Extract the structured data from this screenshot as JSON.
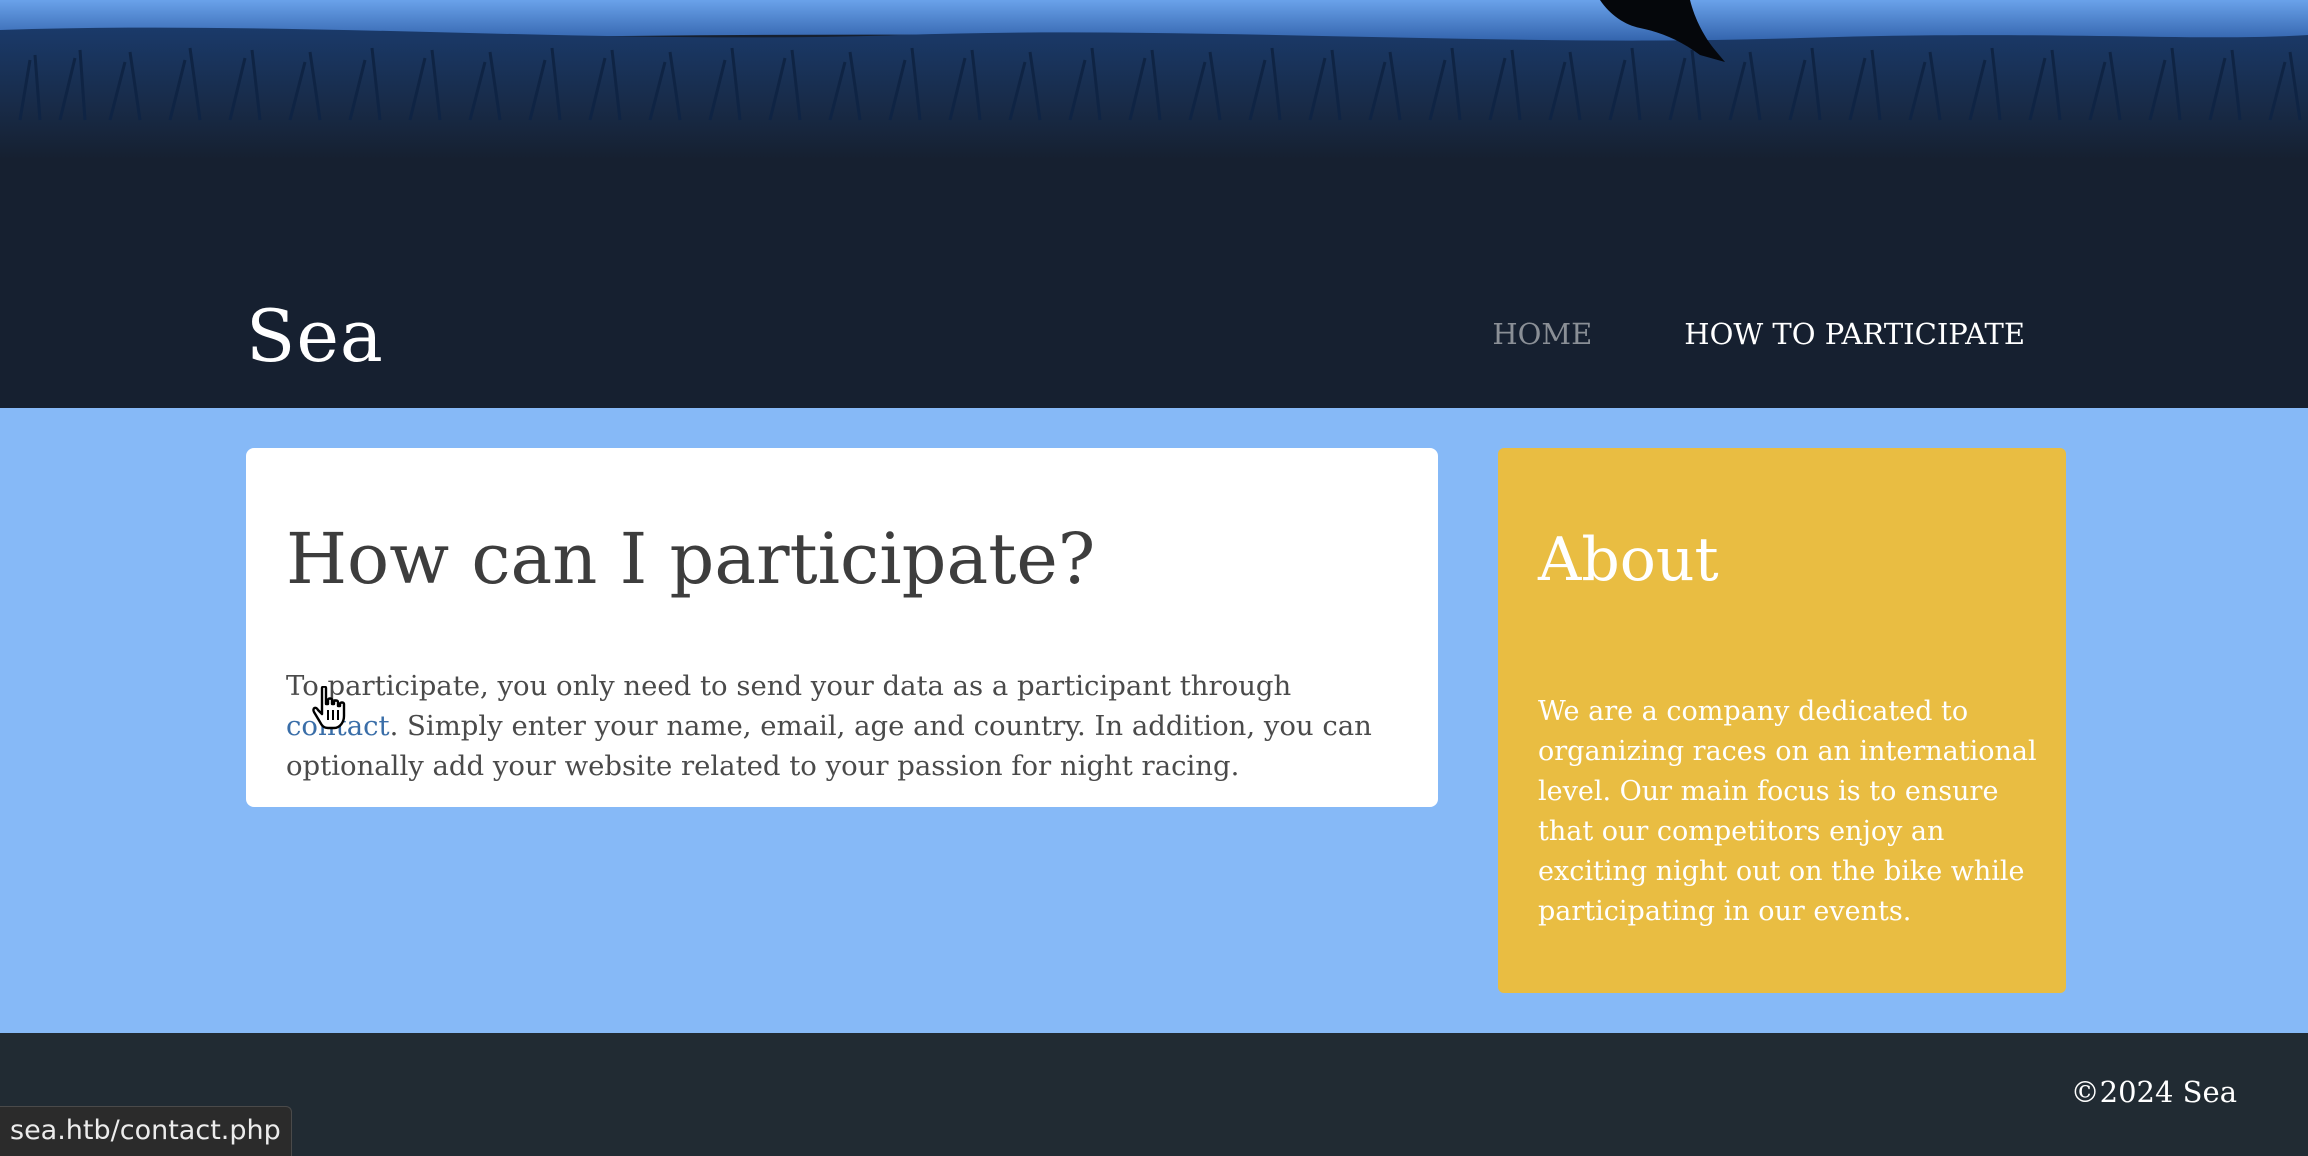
{
  "header": {
    "site_title": "Sea",
    "nav": {
      "home": "HOME",
      "participate": "HOW TO PARTICIPATE"
    }
  },
  "main": {
    "heading": "How can I participate?",
    "intro_before": "To participate, you only need to send your data as a participant through ",
    "contact_link": "contact",
    "intro_after": ". Simply enter your name, email, age and country. In addition, you can optionally add your website related to your passion for night racing."
  },
  "about": {
    "heading": "About",
    "body": "We are a company dedicated to organizing races on an international level. Our main focus is to ensure that our competitors enjoy an exciting night out on the bike while participating in our events."
  },
  "footer": {
    "copyright": "©2024 Sea"
  },
  "status_bar": {
    "url": "sea.htb/contact.php"
  },
  "colors": {
    "header_bg": "#162030",
    "main_bg": "#86b9f7",
    "card_bg": "#ffffff",
    "about_bg": "#e9bd42",
    "footer_bg": "#212b33",
    "link": "#3a6ea8"
  }
}
